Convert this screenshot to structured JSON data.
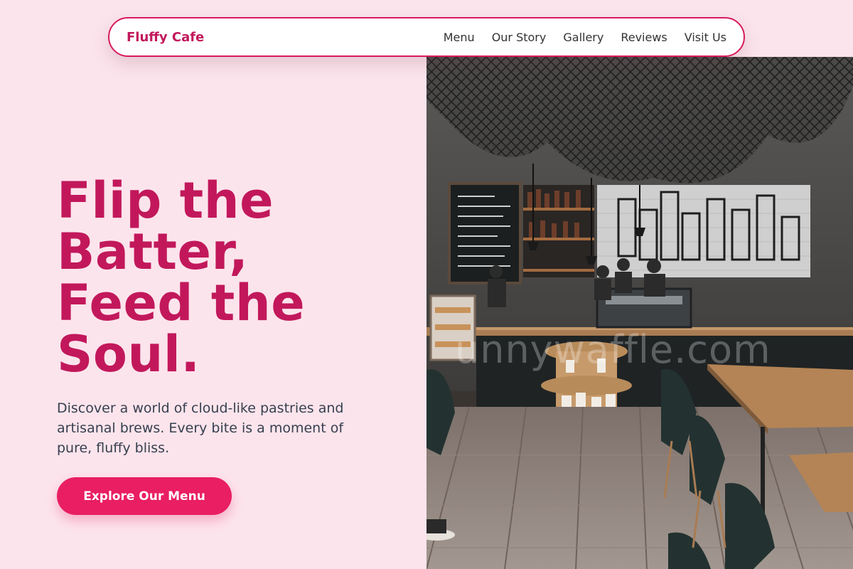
{
  "nav": {
    "brand": "Fluffy Cafe",
    "links": [
      "Menu",
      "Our Story",
      "Gallery",
      "Reviews",
      "Visit Us"
    ]
  },
  "hero": {
    "title_lines": [
      "Flip the",
      "Batter,",
      "Feed the",
      "Soul."
    ],
    "subtitle": "Discover a world of cloud-like pastries and artisanal brews. Every bite is a moment of pure, fluffy bliss.",
    "cta": "Explore Our Menu"
  },
  "photo": {
    "watermark": "unnywaffle.com"
  },
  "colors": {
    "background": "#fce4ec",
    "brand": "#c2185b",
    "accent": "#e91e63",
    "nav_border": "#d81b60",
    "body_text": "#37404f"
  }
}
